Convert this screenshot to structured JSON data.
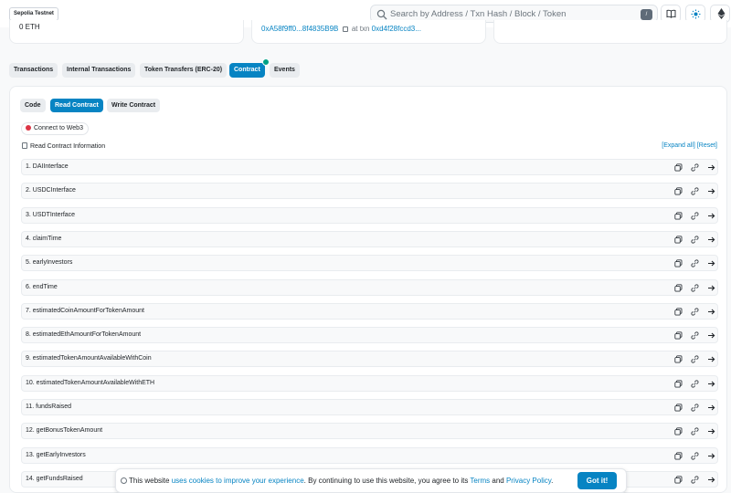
{
  "header": {
    "network_badge": "Sepolia Testnet",
    "search_placeholder": "Search by Address / Txn Hash / Block / Token",
    "search_shortcut": "/"
  },
  "overview": {
    "balance": "0 ETH",
    "creator_address": "0xA58f9ff0...8f4835B9B",
    "at_txn_label": "at txn",
    "creation_txn": "0xd4f28fccd3..."
  },
  "tabs": [
    {
      "label": "Transactions"
    },
    {
      "label": "Internal Transactions"
    },
    {
      "label": "Token Transfers (ERC-20)"
    },
    {
      "label": "Contract"
    },
    {
      "label": "Events"
    }
  ],
  "contract": {
    "subtabs": [
      {
        "label": "Code"
      },
      {
        "label": "Read Contract"
      },
      {
        "label": "Write Contract"
      }
    ],
    "connect_label": "Connect to Web3",
    "info_label": "Read Contract Information",
    "expand_all": "[Expand all]",
    "reset": "[Reset]",
    "functions": [
      "1. DAIInterface",
      "2. USDCInterface",
      "3. USDTInterface",
      "4. claimTime",
      "5. earlyInvestors",
      "6. endTime",
      "7. estimatedCoinAmountForTokenAmount",
      "8. estimatedEthAmountForTokenAmount",
      "9. estimatedTokenAmountAvailableWithCoin",
      "10. estimatedTokenAmountAvailableWithETH",
      "11. fundsRaised",
      "12. getBonusTokenAmount",
      "13. getEarlyInvestors",
      "14. getFundsRaised"
    ]
  },
  "cookie": {
    "text_1": "This website ",
    "link_1": "uses cookies to improve your experience",
    "text_2": ". By continuing to use this website, you agree to its ",
    "link_2": "Terms",
    "text_3": " and ",
    "link_3": "Privacy Policy",
    "text_4": ".",
    "button": "Got it!"
  },
  "colors": {
    "primary": "#0784c3",
    "success": "#00a186",
    "danger": "#dc3545"
  }
}
